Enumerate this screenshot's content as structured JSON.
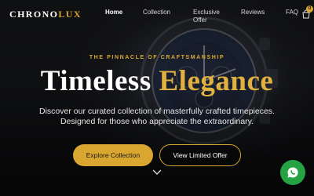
{
  "brand": {
    "name_part1": "CHRONO",
    "name_part2": "LUX",
    "accent": "#d9a730"
  },
  "nav": {
    "items": [
      {
        "label": "Home",
        "active": true
      },
      {
        "label": "Collection"
      },
      {
        "label": "Exclusive Offer"
      },
      {
        "label": "Reviews"
      },
      {
        "label": "FAQ"
      }
    ],
    "cart_icon": "shopping-bag-icon",
    "cart_count": "0"
  },
  "hero": {
    "eyebrow": "THE PINNACLE OF CRAFTSMANSHIP",
    "headline_part1": "Timeless",
    "headline_part2": "Elegance",
    "subtitle_line1": "Discover our curated collection of masterfully crafted timepieces.",
    "subtitle_line2": "Designed for those who appreciate the extraordinary.",
    "primary_cta": "Explore Collection",
    "secondary_cta": "View Limited Offer",
    "scroll_icon": "chevron-down-icon"
  },
  "chat": {
    "icon": "whatsapp-icon",
    "color": "#25a244"
  }
}
